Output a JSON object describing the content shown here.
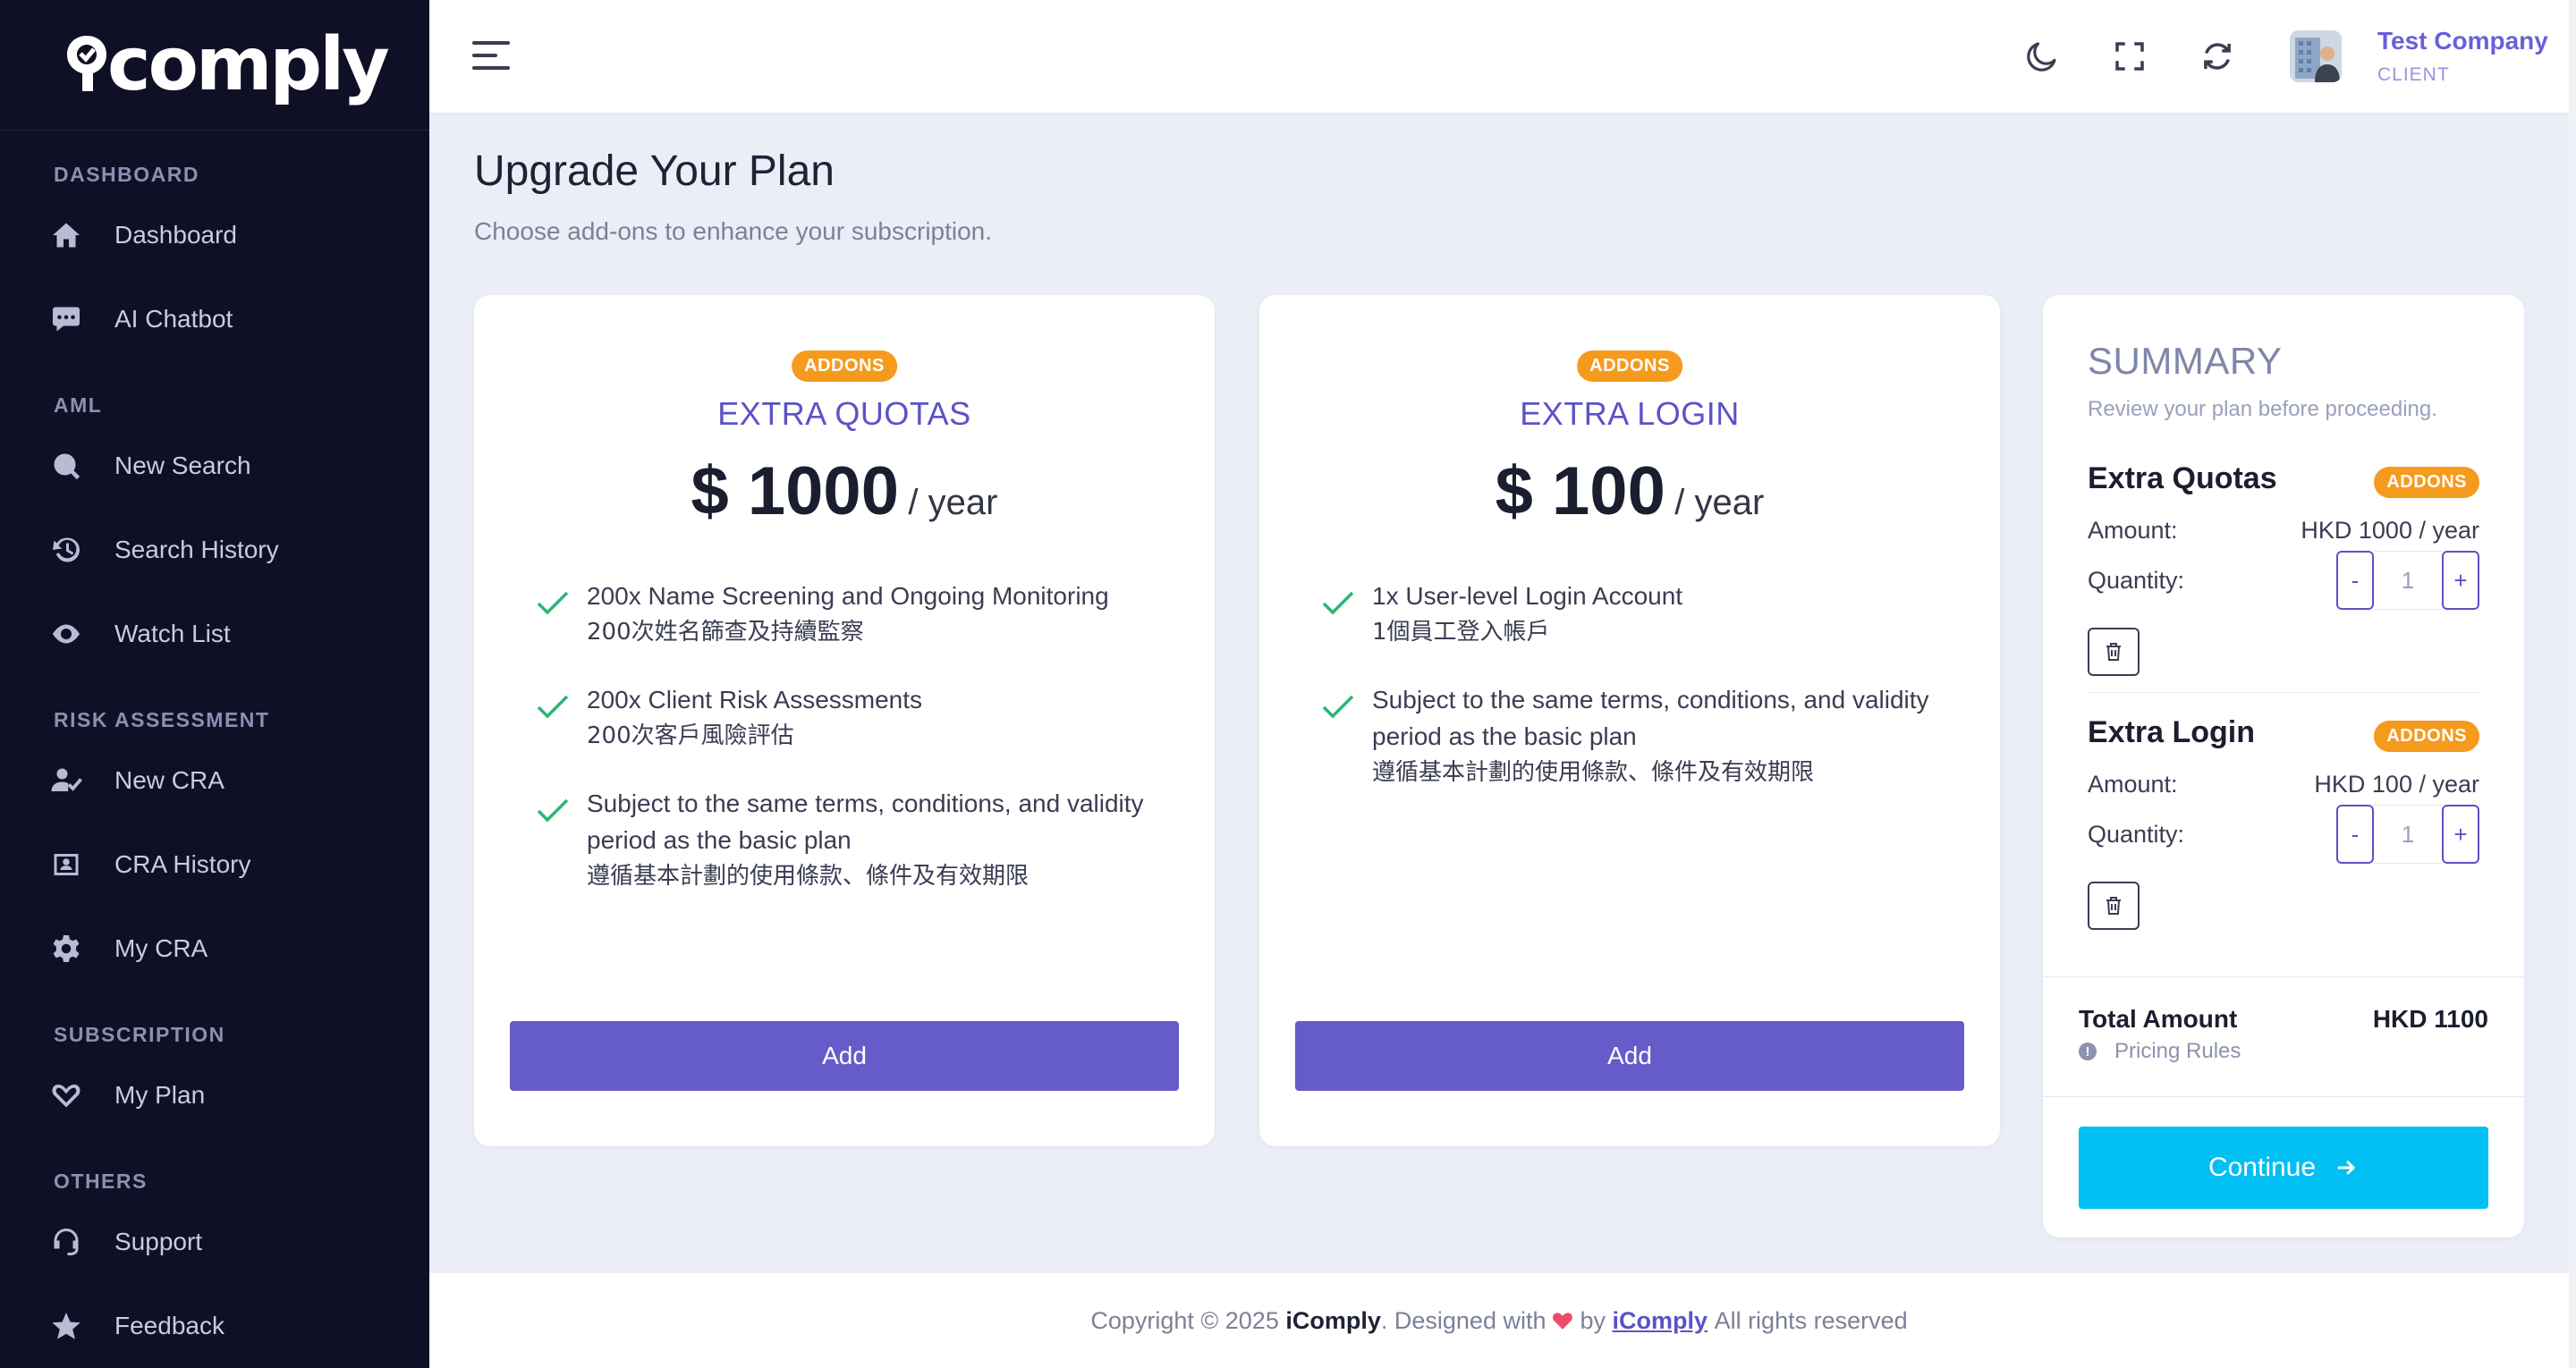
{
  "brand": {
    "name": "comply",
    "logo_alt": "iComply"
  },
  "sidebar": {
    "sections": [
      {
        "label": "DASHBOARD",
        "items": [
          {
            "label": "Dashboard",
            "icon": "home-icon"
          },
          {
            "label": "AI Chatbot",
            "icon": "chat-icon"
          }
        ]
      },
      {
        "label": "AML",
        "items": [
          {
            "label": "New Search",
            "icon": "search-icon"
          },
          {
            "label": "Search History",
            "icon": "history-icon"
          },
          {
            "label": "Watch List",
            "icon": "eye-icon"
          }
        ]
      },
      {
        "label": "RISK ASSESSMENT",
        "items": [
          {
            "label": "New CRA",
            "icon": "user-check-icon"
          },
          {
            "label": "CRA History",
            "icon": "id-card-icon"
          },
          {
            "label": "My CRA",
            "icon": "gear-icon"
          }
        ]
      },
      {
        "label": "SUBSCRIPTION",
        "items": [
          {
            "label": "My Plan",
            "icon": "heart-hand-icon"
          }
        ]
      },
      {
        "label": "OTHERS",
        "items": [
          {
            "label": "Support",
            "icon": "headset-icon"
          },
          {
            "label": "Feedback",
            "icon": "star-icon"
          }
        ]
      }
    ]
  },
  "topbar": {
    "user_name": "Test Company",
    "user_role": "CLIENT",
    "icons": [
      "menu-icon",
      "moon-icon",
      "fullscreen-icon",
      "refresh-icon"
    ]
  },
  "page": {
    "title": "Upgrade Your Plan",
    "subtitle": "Choose add-ons to enhance your subscription."
  },
  "plans": [
    {
      "badge": "ADDONS",
      "title": "EXTRA QUOTAS",
      "price": "$ 1000",
      "period": "/ year",
      "features": [
        {
          "en": "200x Name Screening and Ongoing Monitoring",
          "zh": "200次姓名篩查及持續監察"
        },
        {
          "en": "200x Client Risk Assessments",
          "zh": "200次客戶風險評估"
        },
        {
          "en": "Subject to the same terms, conditions, and validity period as the basic plan",
          "zh": "遵循基本計劃的使用條款、條件及有效期限"
        }
      ],
      "button": "Add"
    },
    {
      "badge": "ADDONS",
      "title": "EXTRA LOGIN",
      "price": "$ 100",
      "period": "/ year",
      "features": [
        {
          "en": "1x User-level Login Account",
          "zh": "1個員工登入帳戶"
        },
        {
          "en": "Subject to the same terms, conditions, and validity period as the basic plan",
          "zh": "遵循基本計劃的使用條款、條件及有效期限"
        }
      ],
      "button": "Add"
    }
  ],
  "summary": {
    "title": "SUMMARY",
    "subtitle": "Review your plan before proceeding.",
    "amount_label": "Amount:",
    "quantity_label": "Quantity:",
    "items": [
      {
        "name": "Extra Quotas",
        "badge": "ADDONS",
        "amount": "HKD 1000 / year",
        "quantity": "1",
        "minus": "-",
        "plus": "+"
      },
      {
        "name": "Extra Login",
        "badge": "ADDONS",
        "amount": "HKD 100 / year",
        "quantity": "1",
        "minus": "-",
        "plus": "+"
      }
    ],
    "total_label": "Total Amount",
    "total_value": "HKD 1100",
    "pricing_rules": "Pricing Rules",
    "continue": "Continue"
  },
  "footer": {
    "prefix": "Copyright © 2025",
    "brand": "iComply",
    "designed": ". Designed with",
    "by": "by",
    "link": "iComply",
    "suffix": "All rights reserved"
  },
  "colors": {
    "accent": "#655bc9",
    "badge": "#f69a1e",
    "continue": "#00bff3",
    "sidebar_bg": "#0f1026",
    "page_bg": "#ECEEF7"
  }
}
